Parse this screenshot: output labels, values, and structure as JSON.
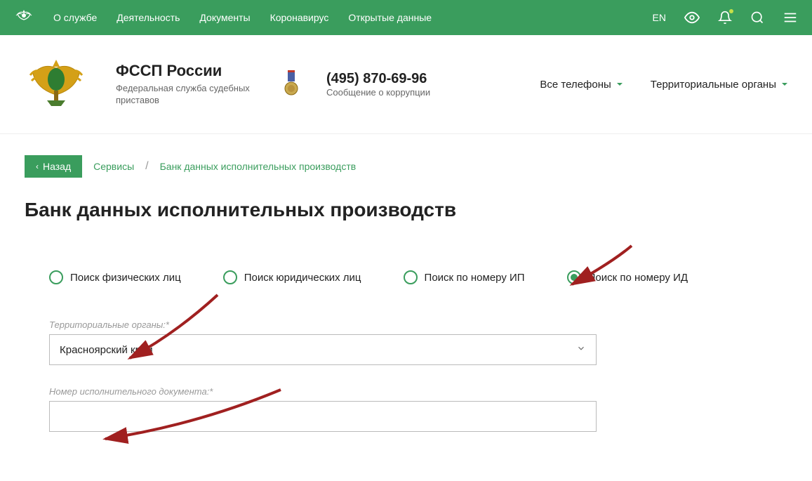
{
  "navbar": {
    "items": [
      "О службе",
      "Деятельность",
      "Документы",
      "Коронавирус",
      "Открытые данные"
    ],
    "lang": "EN"
  },
  "header": {
    "title": "ФССП России",
    "subtitle": "Федеральная служба судебных приставов",
    "phone": "(495) 870-69-96",
    "phone_sub": "Сообщение о коррупции",
    "all_phones": "Все телефоны",
    "territorial": "Территориальные органы"
  },
  "crumbs": {
    "back": "Назад",
    "services": "Сервисы",
    "current": "Банк данных исполнительных производств"
  },
  "page_title": "Банк данных исполнительных производств",
  "tabs": {
    "t1": "Поиск физических лиц",
    "t2": "Поиск юридических лиц",
    "t3": "Поиск по номеру ИП",
    "t4": "Поиск по номеру ИД"
  },
  "form": {
    "territory_label": "Территориальные органы:*",
    "territory_value": "Красноярский край",
    "docnum_label": "Номер исполнительного документа:*",
    "docnum_value": ""
  }
}
